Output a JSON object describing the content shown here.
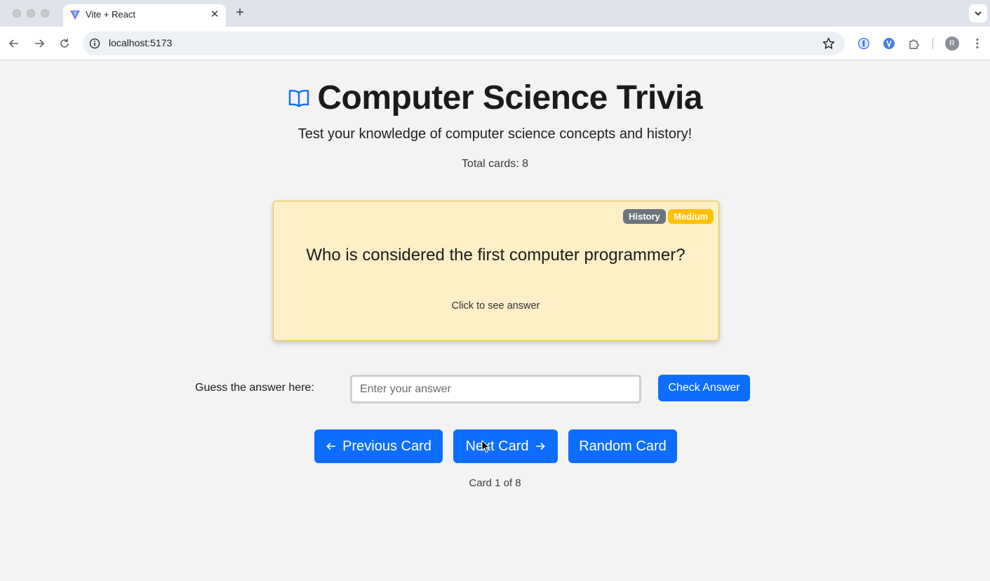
{
  "browser": {
    "tab_title": "Vite + React",
    "url": "localhost:5173",
    "profile_initial": "R"
  },
  "page": {
    "title": "Computer Science Trivia",
    "subtitle": "Test your knowledge of computer science concepts and history!",
    "total_cards": "Total cards: 8"
  },
  "card": {
    "category": "History",
    "difficulty": "Medium",
    "question": "Who is considered the first computer programmer?",
    "hint": "Click to see answer"
  },
  "guess": {
    "label": "Guess the answer here:",
    "placeholder": "Enter your answer",
    "value": "",
    "check_label": "Check Answer"
  },
  "navigation": {
    "previous_label": "Previous Card",
    "next_label": "Next Card",
    "random_label": "Random Card",
    "counter": "Card 1 of 8"
  },
  "colors": {
    "primary": "#0d6efd",
    "card_bg": "#fdefc6",
    "card_border": "#f2c040",
    "badge_category": "#6c757d",
    "badge_difficulty": "#ffc107"
  }
}
